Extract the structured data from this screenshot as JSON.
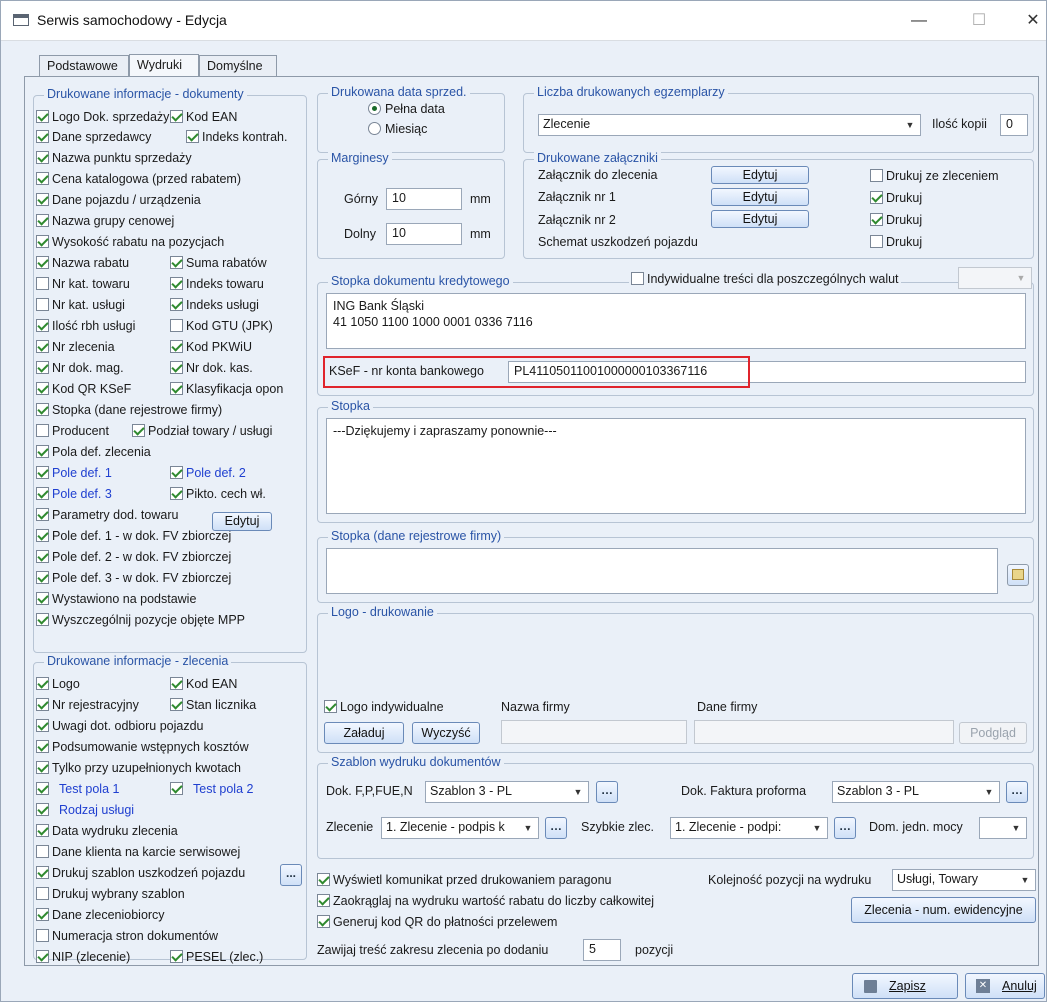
{
  "window": {
    "title": "Serwis samochodowy - Edycja",
    "minimize": "—",
    "maximize": "☐",
    "close": "✕"
  },
  "tabs": [
    "Podstawowe",
    "Wydruki",
    "Domyślne"
  ],
  "doc_info": {
    "legend": "Drukowane informacje - dokumenty",
    "items": [
      {
        "label": "Logo Dok. sprzedaży",
        "checked": true
      },
      {
        "label": "Kod EAN",
        "checked": true
      },
      {
        "label": "Dane sprzedawcy",
        "checked": true
      },
      {
        "label": "Indeks kontrah.",
        "checked": true
      },
      {
        "label": "Nazwa punktu sprzedaży",
        "checked": true
      },
      {
        "label": "Cena katalogowa (przed rabatem)",
        "checked": true
      },
      {
        "label": "Dane pojazdu / urządzenia",
        "checked": true
      },
      {
        "label": "Nazwa grupy cenowej",
        "checked": true
      },
      {
        "label": "Wysokość rabatu na pozycjach",
        "checked": true
      },
      {
        "label": "Nazwa rabatu",
        "checked": true
      },
      {
        "label": "Suma rabatów",
        "checked": true
      },
      {
        "label": "Nr kat. towaru",
        "checked": false
      },
      {
        "label": "Indeks towaru",
        "checked": true
      },
      {
        "label": "Nr kat. usługi",
        "checked": false
      },
      {
        "label": "Indeks usługi",
        "checked": true
      },
      {
        "label": "Ilość rbh usługi",
        "checked": true
      },
      {
        "label": "Kod GTU (JPK)",
        "checked": false
      },
      {
        "label": "Nr zlecenia",
        "checked": true
      },
      {
        "label": "Kod PKWiU",
        "checked": true
      },
      {
        "label": "Nr dok. mag.",
        "checked": true
      },
      {
        "label": "Nr dok. kas.",
        "checked": true
      },
      {
        "label": "Kod QR KSeF",
        "checked": true
      },
      {
        "label": "Klasyfikacja opon",
        "checked": true
      },
      {
        "label": "Stopka (dane rejestrowe firmy)",
        "checked": true
      },
      {
        "label": "Producent",
        "checked": false
      },
      {
        "label": "Podział towary / usługi",
        "checked": true
      },
      {
        "label": "Pola def. zlecenia",
        "checked": true
      },
      {
        "label": "Pole def. 1",
        "checked": true
      },
      {
        "label": "Pole def. 2",
        "checked": true
      },
      {
        "label": "Pole def. 3",
        "checked": true
      },
      {
        "label": "Pikto. cech wł.",
        "checked": true
      },
      {
        "label": "Parametry dod. towaru",
        "checked": true
      },
      {
        "label": "Pole def. 1 - w dok. FV zbiorczej",
        "checked": true
      },
      {
        "label": "Pole def. 2 - w dok. FV zbiorczej",
        "checked": true
      },
      {
        "label": "Pole def. 3 - w dok. FV zbiorczej",
        "checked": true
      },
      {
        "label": "Wystawiono na podstawie",
        "checked": true
      },
      {
        "label": "Wyszczególnij pozycje objęte MPP",
        "checked": true
      }
    ],
    "edit_button": "Edytuj"
  },
  "order_info": {
    "legend": "Drukowane informacje - zlecenia",
    "items": [
      {
        "label": "Logo",
        "checked": true
      },
      {
        "label": "Kod EAN",
        "checked": true
      },
      {
        "label": "Nr rejestracyjny",
        "checked": true
      },
      {
        "label": "Stan licznika",
        "checked": true
      },
      {
        "label": "Uwagi dot. odbioru pojazdu",
        "checked": true
      },
      {
        "label": "Podsumowanie wstępnych kosztów",
        "checked": true
      },
      {
        "label": "Tylko przy uzupełnionych kwotach",
        "checked": true
      },
      {
        "label": "Test pola 1",
        "checked": true
      },
      {
        "label": "Test pola 2",
        "checked": true
      },
      {
        "label": "Rodzaj usługi",
        "checked": true
      },
      {
        "label": "Data wydruku zlecenia",
        "checked": true
      },
      {
        "label": "Dane klienta na karcie serwisowej",
        "checked": false
      },
      {
        "label": "Drukuj szablon uszkodzeń pojazdu",
        "checked": true
      },
      {
        "label": "Drukuj wybrany szablon",
        "checked": false
      },
      {
        "label": "Dane zleceniobiorcy",
        "checked": true
      },
      {
        "label": "Numeracja stron dokumentów",
        "checked": false
      },
      {
        "label": "NIP (zlecenie)",
        "checked": true
      },
      {
        "label": "PESEL (zlec.)",
        "checked": true
      }
    ],
    "dots_button": "..."
  },
  "sale_date": {
    "legend": "Drukowana data sprzed.",
    "options": [
      "Pełna data",
      "Miesiąc"
    ],
    "selected": 0
  },
  "copies": {
    "legend": "Liczba drukowanych egzemplarzy",
    "select_value": "Zlecenie",
    "copies_label": "Ilość kopii",
    "copies_value": "0"
  },
  "margins": {
    "legend": "Marginesy",
    "top_label": "Górny",
    "top_value": "10",
    "bottom_label": "Dolny",
    "bottom_value": "10",
    "unit": "mm"
  },
  "attachments": {
    "legend": "Drukowane załączniki",
    "rows": [
      {
        "label": "Załącznik do zlecenia",
        "button": "Edytuj",
        "check_label": "Drukuj ze zleceniem",
        "checked": false
      },
      {
        "label": "Załącznik nr 1",
        "button": "Edytuj",
        "check_label": "Drukuj",
        "checked": true
      },
      {
        "label": "Załącznik nr 2",
        "button": "Edytuj",
        "check_label": "Drukuj",
        "checked": true
      },
      {
        "label": "Schemat uszkodzeń pojazdu",
        "button": "",
        "check_label": "Drukuj",
        "checked": false
      }
    ]
  },
  "credit_footer": {
    "legend": "Stopka dokumentu kredytowego",
    "individual_label": "Indywidualne treści dla poszczególnych walut",
    "individual_checked": false,
    "text_line1": "ING Bank Śląski",
    "text_line2": "41 1050 1100 1000 0001 0336 7116",
    "ksef_label": "KSeF - nr konta bankowego",
    "ksef_value": "PL41105011001000000103367116"
  },
  "footer": {
    "legend": "Stopka",
    "text": "---Dziękujemy i zapraszamy ponownie---"
  },
  "footer_reg": {
    "legend": "Stopka (dane rejestrowe firmy)"
  },
  "logo": {
    "legend": "Logo - drukowanie",
    "individual_label": "Logo indywidualne",
    "individual_checked": true,
    "company_name_label": "Nazwa firmy",
    "company_data_label": "Dane firmy",
    "load_button": "Załaduj",
    "clear_button": "Wyczyść",
    "preview_button": "Podgląd"
  },
  "templates": {
    "legend": "Szablon wydruku dokumentów",
    "dok_label": "Dok. F,P,FUE,N",
    "dok_value": "Szablon 3 - PL",
    "proforma_label": "Dok. Faktura proforma",
    "proforma_value": "Szablon 3 - PL",
    "order_label": "Zlecenie",
    "order_value": "1. Zlecenie - podpis k",
    "quick_label": "Szybkie zlec.",
    "quick_value": "1. Zlecenie - podpi:",
    "power_label": "Dom. jedn. mocy",
    "power_value": ""
  },
  "bottom": {
    "show_msg": "Wyświetl komunikat przed drukowaniem paragonu",
    "round_discount": "Zaokrąglaj na wydruku wartość rabatu do liczby całkowitej",
    "gen_qr": "Generuj kod QR do płatności przelewem",
    "order_pos_label": "Kolejność pozycji na wydruku",
    "order_pos_value": "Usługi, Towary",
    "orders_button": "Zlecenia - num. ewidencyjne",
    "wrap_label": "Zawijaj treść zakresu zlecenia po dodaniu",
    "wrap_value": "5",
    "wrap_suffix": "pozycji"
  },
  "actions": {
    "save": "Zapisz",
    "cancel": "Anuluj"
  }
}
